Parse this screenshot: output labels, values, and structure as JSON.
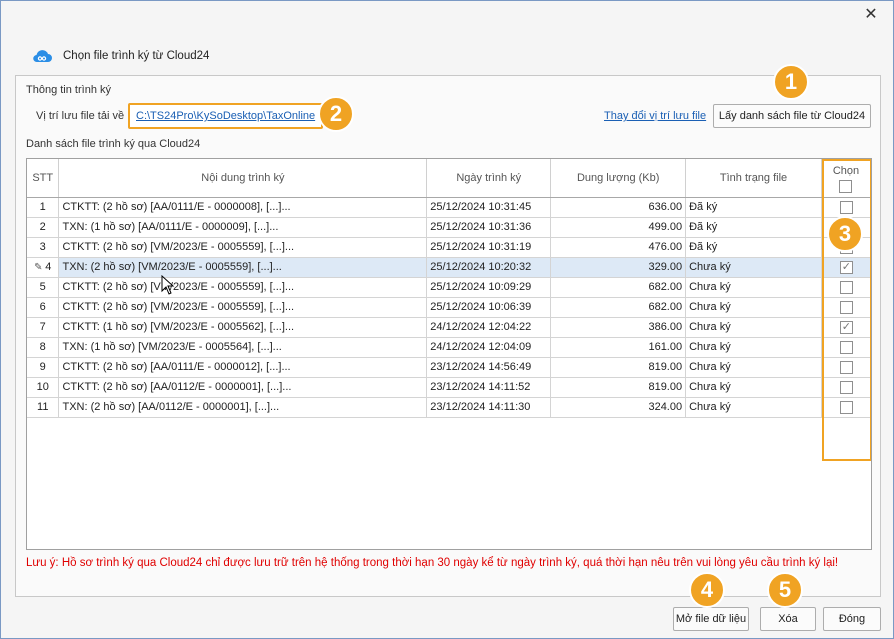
{
  "window": {
    "title": "Chọn file trình ký từ Cloud24",
    "close_label": "✕"
  },
  "info": {
    "group_label": "Thông tin trình ký",
    "location_label": "Vị trí lưu file tải về",
    "location_path": "C:\\TS24Pro\\KySoDesktop\\TaxOnline",
    "change_location": "Thay đổi vị trí lưu file",
    "fetch_button": "Lấy danh sách file từ Cloud24"
  },
  "list": {
    "label": "Danh sách file trình ký qua Cloud24",
    "columns": {
      "stt": "STT",
      "content": "Nội dung trình ký",
      "date": "Ngày trình ký",
      "size": "Dung lượng (Kb)",
      "status": "Tình trạng file",
      "select": "Chọn"
    },
    "rows": [
      {
        "stt": "1",
        "content": "CTKTT: (2 hồ sơ) [AA/0111/E - 0000008], [...]...",
        "date": "25/12/2024 10:31:45",
        "size": "636.00",
        "status": "Đã ký",
        "checked": false
      },
      {
        "stt": "2",
        "content": "TXN: (1 hồ sơ) [AA/0111/E - 0000009], [...]...",
        "date": "25/12/2024 10:31:36",
        "size": "499.00",
        "status": "Đã ký",
        "checked": false
      },
      {
        "stt": "3",
        "content": "CTKTT: (2 hồ sơ) [VM/2023/E - 0005559], [...]...",
        "date": "25/12/2024 10:31:19",
        "size": "476.00",
        "status": "Đã ký",
        "checked": false
      },
      {
        "stt": "4",
        "content": "TXN: (2 hồ sơ) [VM/2023/E - 0005559], [...]...",
        "date": "25/12/2024 10:20:32",
        "size": "329.00",
        "status": "Chưa ký",
        "checked": true
      },
      {
        "stt": "5",
        "content": "CTKTT: (2 hồ sơ) [VM/2023/E - 0005559], [...]...",
        "date": "25/12/2024 10:09:29",
        "size": "682.00",
        "status": "Chưa ký",
        "checked": false
      },
      {
        "stt": "6",
        "content": "CTKTT: (2 hồ sơ) [VM/2023/E - 0005559], [...]...",
        "date": "25/12/2024 10:06:39",
        "size": "682.00",
        "status": "Chưa ký",
        "checked": false
      },
      {
        "stt": "7",
        "content": "CTKTT: (1 hồ sơ) [VM/2023/E - 0005562], [...]...",
        "date": "24/12/2024 12:04:22",
        "size": "386.00",
        "status": "Chưa ký",
        "checked": true
      },
      {
        "stt": "8",
        "content": "TXN: (1 hồ sơ) [VM/2023/E - 0005564], [...]...",
        "date": "24/12/2024 12:04:09",
        "size": "161.00",
        "status": "Chưa ký",
        "checked": false
      },
      {
        "stt": "9",
        "content": "CTKTT: (2 hồ sơ) [AA/0111/E - 0000012], [...]...",
        "date": "23/12/2024 14:56:49",
        "size": "819.00",
        "status": "Chưa ký",
        "checked": false
      },
      {
        "stt": "10",
        "content": "CTKTT: (2 hồ sơ) [AA/0112/E - 0000001], [...]...",
        "date": "23/12/2024 14:11:52",
        "size": "819.00",
        "status": "Chưa ký",
        "checked": false
      },
      {
        "stt": "11",
        "content": "TXN: (2 hồ sơ) [AA/0112/E - 0000001], [...]...",
        "date": "23/12/2024 14:11:30",
        "size": "324.00",
        "status": "Chưa ký",
        "checked": false
      }
    ],
    "selected_row": "4",
    "warning": "Lưu ý: Hồ sơ trình ký qua Cloud24 chỉ được lưu trữ trên hệ thống trong thời hạn 30 ngày kể từ ngày trình ký, quá thời hạn nêu trên vui lòng yêu cầu trình ký lại!"
  },
  "buttons": {
    "open_file": "Mở file dữ liệu",
    "delete": "Xóa",
    "close": "Đóng"
  },
  "badges": [
    "1",
    "2",
    "3",
    "4",
    "5"
  ],
  "colors": {
    "accent": "#f0a323",
    "link": "#1a5fb4",
    "warning": "#e00000",
    "selected_row": "#dde9f6"
  }
}
